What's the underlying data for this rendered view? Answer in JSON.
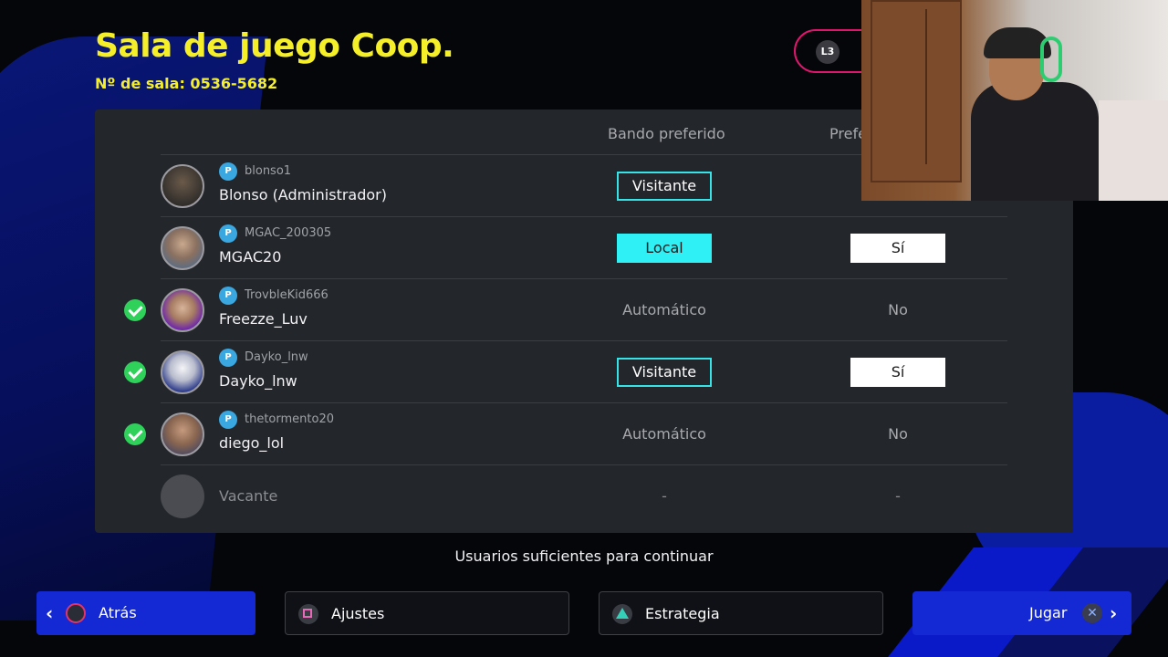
{
  "header": {
    "title": "Sala de juego Coop.",
    "room_number": "Nº de sala: 0536-5682",
    "l3_label": "L3"
  },
  "table": {
    "columns": {
      "side": "Bando preferido",
      "pref": "Prefe"
    },
    "rows": [
      {
        "psn_id": "blonso1",
        "name": "Blonso (Administrador)",
        "ready": false,
        "side": "Visitante",
        "side_style": "outline",
        "pref": "",
        "pref_style": "none"
      },
      {
        "psn_id": "MGAC_200305",
        "name": "MGAC20",
        "ready": false,
        "side": "Local",
        "side_style": "filled",
        "pref": "Sí",
        "pref_style": "box"
      },
      {
        "psn_id": "TrovbleKid666",
        "name": "Freezze_Luv",
        "ready": true,
        "side": "Automático",
        "side_style": "text",
        "pref": "No",
        "pref_style": "text"
      },
      {
        "psn_id": "Dayko_lnw",
        "name": "Dayko_lnw",
        "ready": true,
        "side": "Visitante",
        "side_style": "outline",
        "pref": "Sí",
        "pref_style": "box"
      },
      {
        "psn_id": "thetormento20",
        "name": "diego_lol",
        "ready": true,
        "side": "Automático",
        "side_style": "text",
        "pref": "No",
        "pref_style": "text"
      }
    ],
    "vacant": {
      "label": "Vacante",
      "side": "-",
      "pref": "-"
    }
  },
  "status_message": "Usuarios suficientes para continuar",
  "footer": {
    "back": "Atrás",
    "settings": "Ajustes",
    "strategy": "Estrategia",
    "play": "Jugar"
  },
  "colors": {
    "title": "#f5ef2a",
    "accent_cyan": "#2ff0f5",
    "button_blue": "#1428d4",
    "ready_green": "#2fd15b"
  }
}
